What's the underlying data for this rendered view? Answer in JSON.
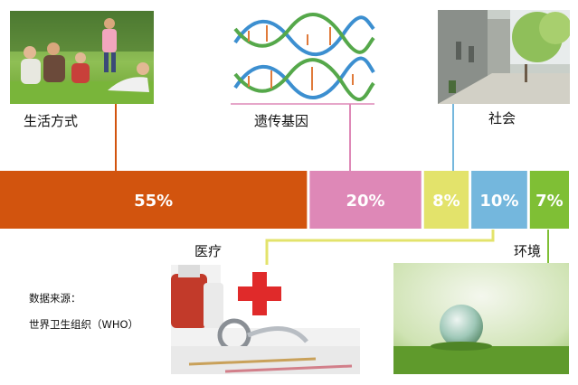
{
  "chart_data": {
    "type": "bar",
    "orientation": "horizontal-stacked",
    "categories": [
      "生活方式",
      "遗传基因",
      "医疗",
      "社会",
      "环境"
    ],
    "values": [
      55,
      20,
      10,
      8,
      7
    ],
    "display_labels": [
      "55%",
      "20%",
      "10%",
      "8%",
      "7%"
    ],
    "unit": "%",
    "colors": [
      "#d2540e",
      "#de88b7",
      "#74b7dd",
      "#e3e36b",
      "#7fbf35"
    ],
    "segment_order": [
      0,
      1,
      3,
      2,
      4
    ]
  },
  "source": {
    "line1": "数据来源：",
    "line2": "世界卫生组织（WHO）"
  },
  "images": {
    "lifestyle": "family-photo",
    "genetics": "dna-helix-illustration",
    "society": "street-photo",
    "medical": "medical-kit-photo",
    "environment": "glass-globe-on-grass-photo"
  }
}
